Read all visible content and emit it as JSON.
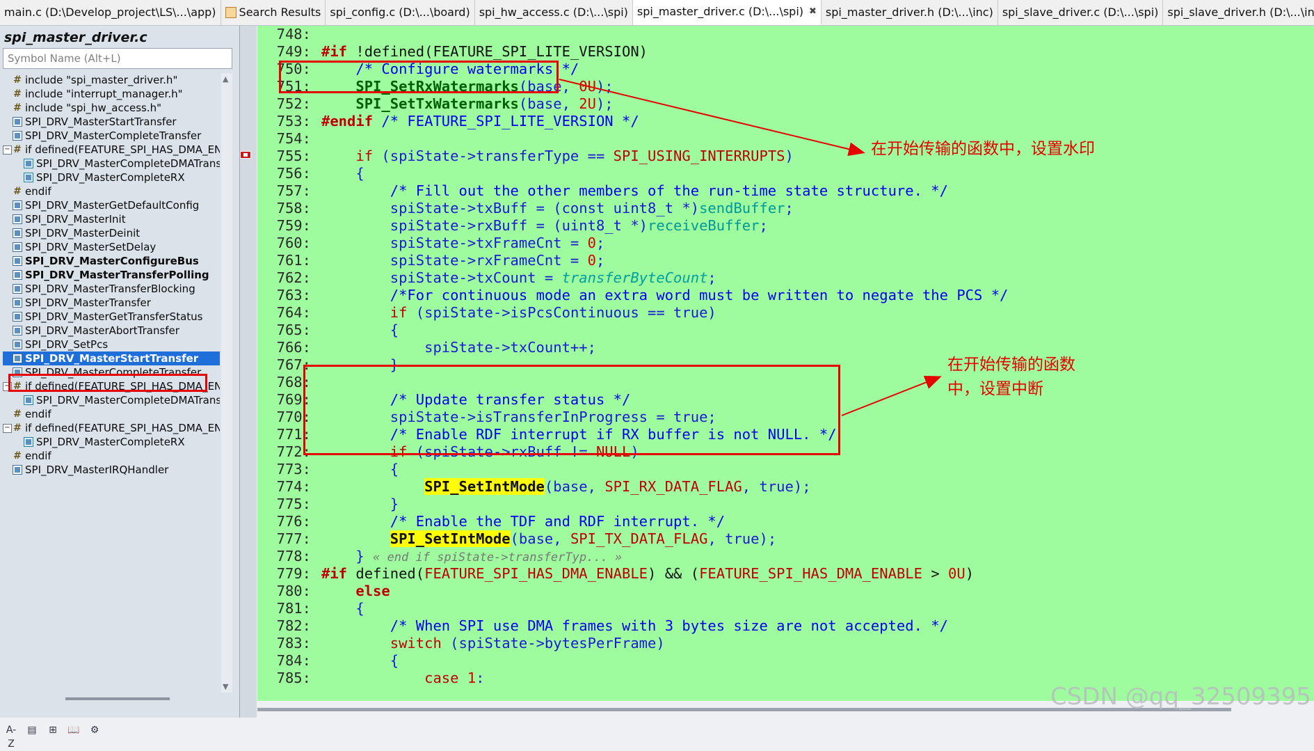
{
  "tabs": [
    {
      "label": "main.c (D:\\Develop_project\\LS\\...\\app)",
      "active": false
    },
    {
      "label": "Search Results",
      "active": false,
      "icon": "search-results-icon"
    },
    {
      "label": "spi_config.c (D:\\...\\board)",
      "active": false
    },
    {
      "label": "spi_hw_access.c (D:\\...\\spi)",
      "active": false
    },
    {
      "label": "spi_master_driver.c (D:\\...\\spi)",
      "active": true,
      "close": "✖"
    },
    {
      "label": "spi_master_driver.h (D:\\...\\inc)",
      "active": false
    },
    {
      "label": "spi_slave_driver.c (D:\\...\\spi)",
      "active": false
    },
    {
      "label": "spi_slave_driver.h (D:\\...\\inc)",
      "active": false
    }
  ],
  "tab_overflow": "⌄",
  "left_panel": {
    "file_title": "spi_master_driver.c",
    "search_placeholder": "Symbol Name (Alt+L)",
    "symbols": [
      {
        "label": "include \"spi_master_driver.h\"",
        "icon": "hash",
        "indent": 1
      },
      {
        "label": "include \"interrupt_manager.h\"",
        "icon": "hash",
        "indent": 1
      },
      {
        "label": "include \"spi_hw_access.h\"",
        "icon": "hash",
        "indent": 1
      },
      {
        "label": "SPI_DRV_MasterStartTransfer",
        "icon": "fn",
        "indent": 1
      },
      {
        "label": "SPI_DRV_MasterCompleteTransfer",
        "icon": "fn",
        "indent": 1
      },
      {
        "label": "if defined(FEATURE_SPI_HAS_DMA_EN",
        "icon": "hash",
        "indent": 0,
        "toggle": "⊟"
      },
      {
        "label": "SPI_DRV_MasterCompleteDMATransfer",
        "icon": "fn2",
        "indent": 2
      },
      {
        "label": "SPI_DRV_MasterCompleteRX",
        "icon": "fn2",
        "indent": 2
      },
      {
        "label": "endif",
        "icon": "hash",
        "indent": 1
      },
      {
        "label": "SPI_DRV_MasterGetDefaultConfig",
        "icon": "fn",
        "indent": 1
      },
      {
        "label": "SPI_DRV_MasterInit",
        "icon": "fn",
        "indent": 1
      },
      {
        "label": "SPI_DRV_MasterDeinit",
        "icon": "fn",
        "indent": 1
      },
      {
        "label": "SPI_DRV_MasterSetDelay",
        "icon": "fn",
        "indent": 1
      },
      {
        "label": "SPI_DRV_MasterConfigureBus",
        "icon": "fn",
        "indent": 1,
        "bold": true
      },
      {
        "label": "SPI_DRV_MasterTransferPolling",
        "icon": "fn",
        "indent": 1,
        "bold": true
      },
      {
        "label": "SPI_DRV_MasterTransferBlocking",
        "icon": "fn",
        "indent": 1
      },
      {
        "label": "SPI_DRV_MasterTransfer",
        "icon": "fn",
        "indent": 1
      },
      {
        "label": "SPI_DRV_MasterGetTransferStatus",
        "icon": "fn",
        "indent": 1
      },
      {
        "label": "SPI_DRV_MasterAbortTransfer",
        "icon": "fn",
        "indent": 1
      },
      {
        "label": "SPI_DRV_SetPcs",
        "icon": "fn",
        "indent": 1
      },
      {
        "label": "SPI_DRV_MasterStartTransfer",
        "icon": "fn",
        "indent": 1,
        "selected": true
      },
      {
        "label": "SPI_DRV_MasterCompleteTransfer",
        "icon": "fn",
        "indent": 1
      },
      {
        "label": "if defined(FEATURE_SPI_HAS_DMA_EN",
        "icon": "hash",
        "indent": 0,
        "toggle": "⊟"
      },
      {
        "label": "SPI_DRV_MasterCompleteDMATransfer",
        "icon": "fn2",
        "indent": 2
      },
      {
        "label": "endif",
        "icon": "hash",
        "indent": 1
      },
      {
        "label": "if defined(FEATURE_SPI_HAS_DMA_EN",
        "icon": "hash",
        "indent": 0,
        "toggle": "⊟"
      },
      {
        "label": "SPI_DRV_MasterCompleteRX",
        "icon": "fn2",
        "indent": 2
      },
      {
        "label": "endif",
        "icon": "hash",
        "indent": 1
      },
      {
        "label": "SPI_DRV_MasterIRQHandler",
        "icon": "fn",
        "indent": 1
      }
    ],
    "bottom_tools": [
      "A-Z",
      "▤",
      "⊞",
      "📖",
      "⚙"
    ]
  },
  "editor": {
    "lines": [
      {
        "n": "748:",
        "html": ""
      },
      {
        "n": "749:",
        "html": "<span class='pp'>#if</span> <span class='fn'>!defined(FEATURE_SPI_LITE_VERSION)</span>"
      },
      {
        "n": "750:",
        "html": "    <span class='cm'>/* Configure watermarks */</span>"
      },
      {
        "n": "751:",
        "html": "    <span class='grn'>SPI_SetRxWatermarks</span><span class='id'>(base, </span><span class='num'>0U</span><span class='id'>);</span>"
      },
      {
        "n": "752:",
        "html": "    <span class='grn'>SPI_SetTxWatermarks</span><span class='id'>(base, </span><span class='num'>2U</span><span class='id'>);</span>"
      },
      {
        "n": "753:",
        "html": "<span class='pp'>#endif</span> <span class='cm'>/* FEATURE_SPI_LITE_VERSION */</span>"
      },
      {
        "n": "754:",
        "html": ""
      },
      {
        "n": "755:",
        "html": "    <span class='kw'>if</span> <span class='id'>(spiState-&gt;transferType == </span><span class='mac'>SPI_USING_INTERRUPTS</span><span class='id'>)</span>"
      },
      {
        "n": "756:",
        "html": "    <span class='id'>{</span>"
      },
      {
        "n": "757:",
        "html": "        <span class='cm'>/* Fill out the other members of the run-time state structure. */</span>"
      },
      {
        "n": "758:",
        "html": "        <span class='id'>spiState-&gt;txBuff = (const uint8_t *)</span><span class='teal'>sendBuffer</span><span class='id'>;</span>"
      },
      {
        "n": "759:",
        "html": "        <span class='id'>spiState-&gt;rxBuff = (uint8_t *)</span><span class='teal'>receiveBuffer</span><span class='id'>;</span>"
      },
      {
        "n": "760:",
        "html": "        <span class='id'>spiState-&gt;txFrameCnt = </span><span class='num'>0</span><span class='id'>;</span>"
      },
      {
        "n": "761:",
        "html": "        <span class='id'>spiState-&gt;rxFrameCnt = </span><span class='num'>0</span><span class='id'>;</span>"
      },
      {
        "n": "762:",
        "html": "        <span class='id'>spiState-&gt;txCount = </span><span class='ital'>transferByteCount</span><span class='id'>;</span>"
      },
      {
        "n": "763:",
        "html": "        <span class='cm'>/*For continuous mode an extra word must be written to negate the PCS */</span>"
      },
      {
        "n": "764:",
        "html": "        <span class='kw'>if</span> <span class='id'>(spiState-&gt;isPcsContinuous == true)</span>"
      },
      {
        "n": "765:",
        "html": "        <span class='id'>{</span>"
      },
      {
        "n": "766:",
        "html": "            <span class='id'>spiState-&gt;txCount++;</span>"
      },
      {
        "n": "767:",
        "html": "        <span class='id'>}</span>"
      },
      {
        "n": "768:",
        "html": ""
      },
      {
        "n": "769:",
        "html": "        <span class='cm'>/* Update transfer status */</span>"
      },
      {
        "n": "770:",
        "html": "        <span class='id'>spiState-&gt;isTransferInProgress = true;</span>"
      },
      {
        "n": "771:",
        "html": "        <span class='cm'>/* Enable RDF interrupt if RX buffer is not NULL. */</span>"
      },
      {
        "n": "772:",
        "html": "        <span class='kw'>if</span> <span class='id'>(spiState-&gt;rxBuff != </span><span class='mac'>NULL</span><span class='id'>)</span>"
      },
      {
        "n": "773:",
        "html": "        <span class='id'>{</span>"
      },
      {
        "n": "774:",
        "html": "            <span class='hl'>SPI_SetIntMode</span><span class='id'>(base, </span><span class='mac'>SPI_RX_DATA_FLAG</span><span class='id'>, true);</span>"
      },
      {
        "n": "775:",
        "html": "        <span class='id'>}</span>"
      },
      {
        "n": "776:",
        "html": "        <span class='cm'>/* Enable the TDF and RDF interrupt. */</span>"
      },
      {
        "n": "777:",
        "html": "        <span class='hl'>SPI_SetIntMode</span><span class='id'>(base, </span><span class='mac'>SPI_TX_DATA_FLAG</span><span class='id'>, true);</span>"
      },
      {
        "n": "778:",
        "html": "    <span class='id'>}</span> <span class='fold'>« end if spiState-&gt;transferTyp... »</span>"
      },
      {
        "n": "779:",
        "html": "<span class='pp'>#if</span> <span class='fn'>defined(</span><span class='mac'>FEATURE_SPI_HAS_DMA_ENABLE</span><span class='fn'>) &amp;&amp; (</span><span class='mac'>FEATURE_SPI_HAS_DMA_ENABLE</span><span class='fn'> &gt; </span><span class='num'>0U</span><span class='fn'>)</span>"
      },
      {
        "n": "780:",
        "html": "    <span class='pp'>else</span>"
      },
      {
        "n": "781:",
        "html": "    <span class='id'>{</span>"
      },
      {
        "n": "782:",
        "html": "        <span class='cm'>/* When SPI use DMA frames with 3 bytes size are not accepted. */</span>"
      },
      {
        "n": "783:",
        "html": "        <span class='kw'>switch</span> <span class='id'>(spiState-&gt;bytesPerFrame)</span>"
      },
      {
        "n": "784:",
        "html": "        <span class='id'>{</span>"
      },
      {
        "n": "785:",
        "html": "            <span class='kw'>case</span> <span class='num'>1</span><span class='id'>:</span>"
      }
    ]
  },
  "annotations": {
    "watermark_note": "在开始传输的函数中，设置水印",
    "interrupt_note_line1": "在开始传输的函数",
    "interrupt_note_line2": "中，设置中断"
  },
  "watermark_text": "CSDN @qq_32509395",
  "colors": {
    "editor_bg": "#9efc9e",
    "annotation_red": "#e60000",
    "selection_blue": "#1e6fd9",
    "highlight_yellow": "#ffff00"
  }
}
